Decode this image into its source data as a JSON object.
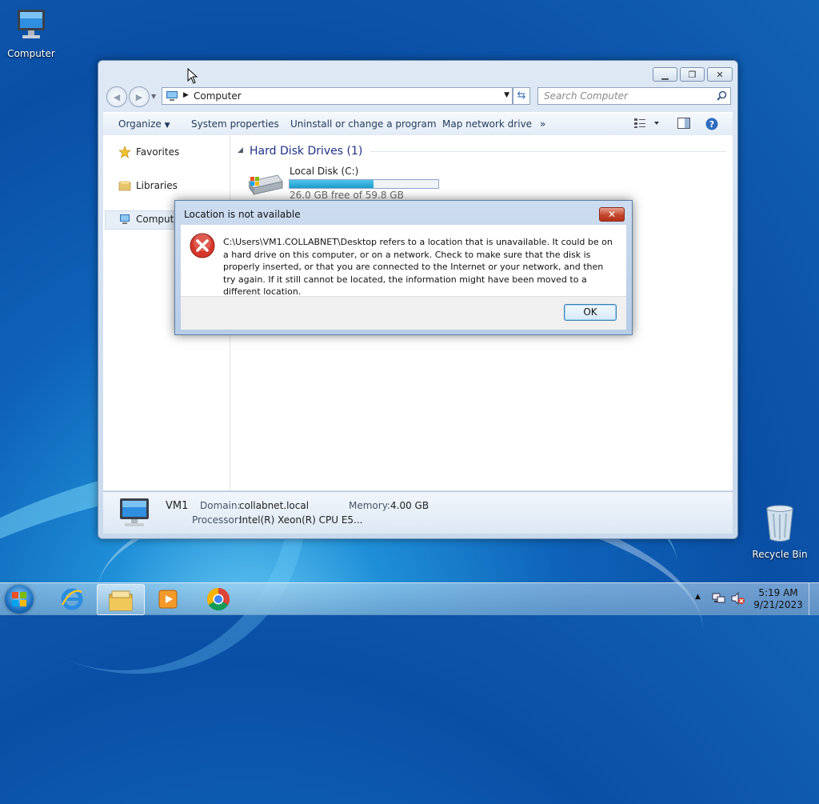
{
  "desktop": {
    "icons": [
      {
        "label": "Computer",
        "icon": "computer-icon"
      },
      {
        "label": "Recycle Bin",
        "icon": "recycle-bin-icon"
      }
    ]
  },
  "explorer": {
    "caption_buttons": {
      "minimize": "minimize-icon",
      "maximize": "maximize-icon",
      "close": "close-icon"
    },
    "address": {
      "segment": "Computer"
    },
    "search": {
      "placeholder": "Search Computer"
    },
    "toolbar": {
      "organize": "Organize",
      "system_properties": "System properties",
      "uninstall": "Uninstall or change a program",
      "map_drive": "Map network drive",
      "more": "»"
    },
    "nav": {
      "favorites": "Favorites",
      "libraries": "Libraries",
      "computer": "Computer"
    },
    "section": {
      "title": "Hard Disk Drives (1)"
    },
    "drive": {
      "name": "Local Disk (C:)",
      "free_text": "26.0 GB free of 59.8 GB",
      "used_fraction": 0.565
    },
    "details": {
      "name": "VM1",
      "domain_label": "Domain:",
      "domain_value": "collabnet.local",
      "memory_label": "Memory:",
      "memory_value": "4.00 GB",
      "processor_label": "Processor:",
      "processor_value": "Intel(R) Xeon(R) CPU E5..."
    }
  },
  "dialog": {
    "title": "Location is not available",
    "message": "C:\\Users\\VM1.COLLABNET\\Desktop refers to a location that is unavailable. It could be on a hard drive on this computer, or on a network. Check to make sure that the disk is properly inserted, or that you are connected to the Internet or your network, and then try again. If it still cannot be located, the information might have been moved to a different location.",
    "ok_label": "OK",
    "icon": "error-icon"
  },
  "taskbar": {
    "apps": [
      "internet-explorer-icon",
      "file-explorer-icon",
      "media-player-icon",
      "chrome-icon"
    ],
    "clock": {
      "time": "5:19 AM",
      "date": "9/21/2023"
    }
  }
}
